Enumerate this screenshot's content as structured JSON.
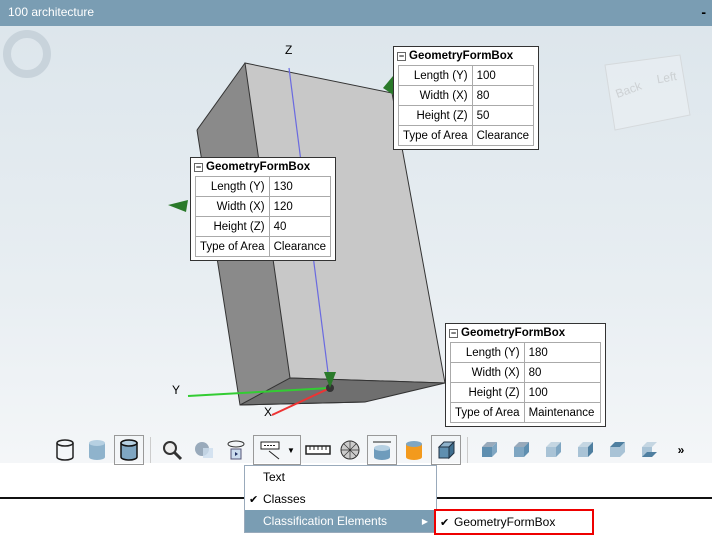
{
  "window": {
    "title": "100 architecture",
    "minimize": "-"
  },
  "axes": {
    "z": "Z",
    "y": "Y",
    "x": "X"
  },
  "viewcube": {
    "back": "Back",
    "left": "Left"
  },
  "boxes": [
    {
      "title": "GeometryFormBox",
      "rows": [
        [
          "Length (Y)",
          "100"
        ],
        [
          "Width (X)",
          "80"
        ],
        [
          "Height (Z)",
          "50"
        ],
        [
          "Type of Area",
          "Clearance"
        ]
      ]
    },
    {
      "title": "GeometryFormBox",
      "rows": [
        [
          "Length (Y)",
          "130"
        ],
        [
          "Width (X)",
          "120"
        ],
        [
          "Height (Z)",
          "40"
        ],
        [
          "Type of Area",
          "Clearance"
        ]
      ]
    },
    {
      "title": "GeometryFormBox",
      "rows": [
        [
          "Length (Y)",
          "180"
        ],
        [
          "Width (X)",
          "80"
        ],
        [
          "Height (Z)",
          "100"
        ],
        [
          "Type of Area",
          "Maintenance"
        ]
      ]
    }
  ],
  "toolbar": {
    "more": "»"
  },
  "menu": {
    "items": [
      {
        "label": "Text",
        "checked": false
      },
      {
        "label": "Classes",
        "checked": true
      },
      {
        "label": "Classification Elements",
        "submenu": true
      }
    ],
    "check": "✔",
    "arrow": "▶"
  },
  "submenu": {
    "label": "GeometryFormBox",
    "checked": true
  }
}
